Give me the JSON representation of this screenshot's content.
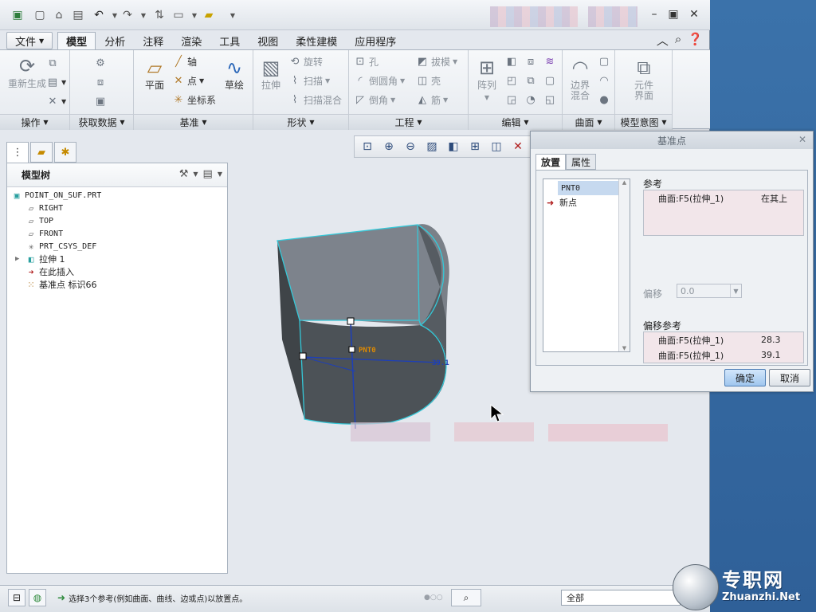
{
  "ribbon_tabs": [
    "文件",
    "模型",
    "分析",
    "注释",
    "渲染",
    "工具",
    "视图",
    "柔性建模",
    "应用程序"
  ],
  "ribbon": {
    "operations": {
      "regenerate": "重新生成",
      "label": "操作"
    },
    "get_data": {
      "label": "获取数据"
    },
    "datum": {
      "plane": "平面",
      "axis": "轴",
      "point": "点",
      "csys": "坐标系",
      "sketch": "草绘",
      "label": "基准"
    },
    "shapes": {
      "extrude": "拉伸",
      "revolve": "旋转",
      "sweep": "扫描",
      "swept_blend": "扫描混合",
      "label": "形状"
    },
    "engineering": {
      "hole": "孔",
      "round": "倒圆角",
      "chamfer": "倒角",
      "draft": "拔模",
      "shell": "壳",
      "rib": "筋",
      "label": "工程"
    },
    "editing": {
      "pattern": "阵列",
      "label": "编辑"
    },
    "surfaces": {
      "boundary_blend": "边界混合",
      "label": "曲面"
    },
    "model_intent": {
      "component_interface": "元件界面",
      "label": "模型意图"
    }
  },
  "model_tree": {
    "title": "模型树",
    "items": [
      {
        "label": "POINT_ON_SUF.PRT",
        "icon": "part-icon"
      },
      {
        "label": "RIGHT",
        "icon": "plane-icon"
      },
      {
        "label": "TOP",
        "icon": "plane-icon"
      },
      {
        "label": "FRONT",
        "icon": "plane-icon"
      },
      {
        "label": "PRT_CSYS_DEF",
        "icon": "csys-icon"
      },
      {
        "label": "拉伸 1",
        "icon": "extrude-icon"
      },
      {
        "label": "在此插入",
        "icon": "insert-arrow-icon"
      },
      {
        "label": "基准点 标识66",
        "icon": "datum-point-icon"
      }
    ]
  },
  "viewport": {
    "point_label": "PNT0",
    "dimension_value": "39.1"
  },
  "dialog": {
    "title": "基准点",
    "tabs": [
      "放置",
      "属性"
    ],
    "collector_items": [
      "PNT0",
      "新点"
    ],
    "references_label": "参考",
    "references": [
      {
        "surface": "曲面:F5(拉伸_1)",
        "constraint": "在其上"
      }
    ],
    "offset_label": "偏移",
    "offset_value": "0.0",
    "offset_refs_label": "偏移参考",
    "offset_refs": [
      {
        "surface": "曲面:F5(拉伸_1)",
        "value": "28.3"
      },
      {
        "surface": "曲面:F5(拉伸_1)",
        "value": "39.1"
      }
    ],
    "ok": "确定",
    "cancel": "取消"
  },
  "status": {
    "message": "选择3个参考(例如曲面、曲线、边或点)以放置点。",
    "filter": "全部"
  },
  "watermark": {
    "text": "专职网",
    "url": "Zhuanzhi.Net"
  },
  "colors": {
    "accent": "#4f7fb6",
    "model_edge": "#35c8d8",
    "dimension": "#1d3fb8",
    "point_label": "#e08a00"
  }
}
